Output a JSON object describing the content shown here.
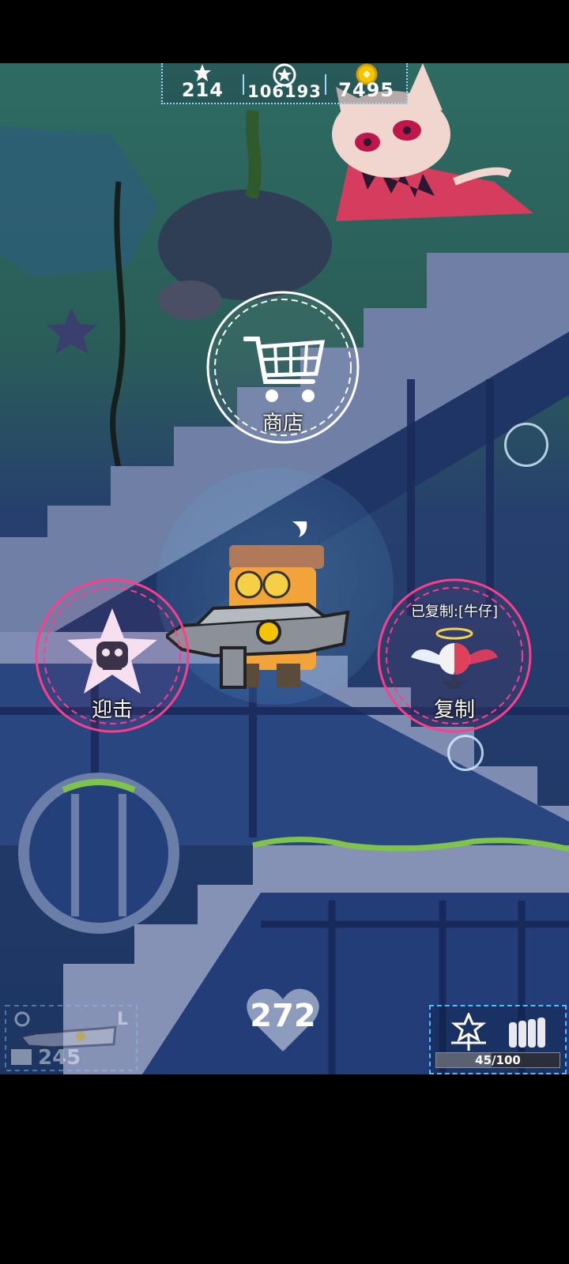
{
  "hud": {
    "stars": "214",
    "medals": "106193",
    "coins": "7495"
  },
  "buttons": {
    "shop": "商店",
    "counter": "迎击",
    "copy": "复制",
    "copied_status": "已复制:[牛仔]"
  },
  "player": {
    "hp": "272"
  },
  "weapon": {
    "ammo": "245",
    "slot_label": "L"
  },
  "skill": {
    "progress_text": "45/100",
    "progress_fraction": 0.45
  },
  "colors": {
    "pink_ring": "#ff3d8b",
    "hud_border": "#9fd7ff",
    "coin": "#f5c400"
  }
}
